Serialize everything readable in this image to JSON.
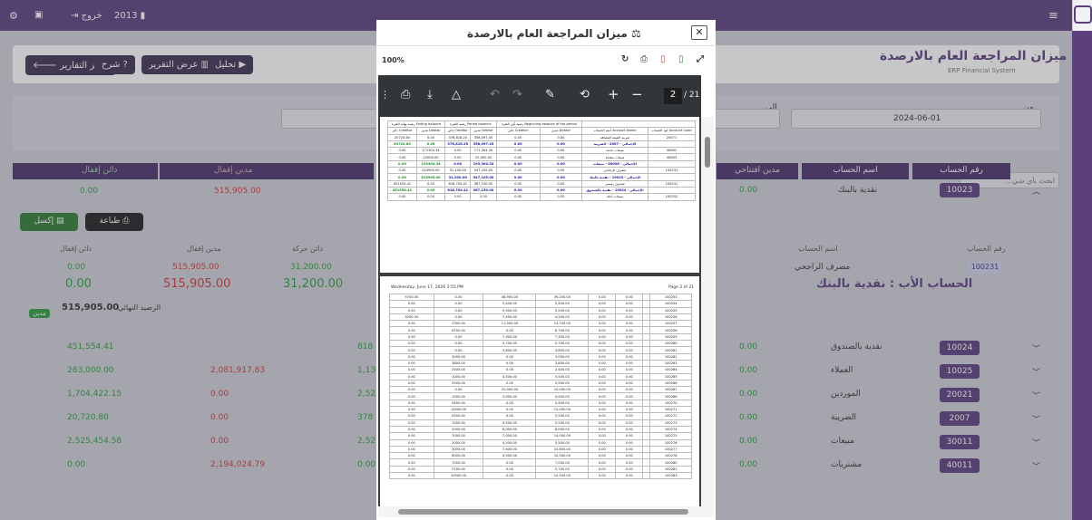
{
  "topbar": {
    "year": "2013",
    "logout": "خروج"
  },
  "header": {
    "title": "ميزان المراجعة العام بالارصدة",
    "subtitle": "ERP Financial System"
  },
  "actions": {
    "reports_center": "مركز التقارير",
    "explain": "شرح",
    "view_report": "عرض التقرير",
    "analysis": "تحليل"
  },
  "filters": {
    "from_label": "من",
    "from_value": "2024-06-01",
    "to_label": "إلى",
    "search_placeholder": "...ابحث بأي شي"
  },
  "table_headers": {
    "account_no": "رقم الحساب",
    "account_name": "اسم الحساب",
    "opening_debit": "مدين افتتاحي",
    "closing_debit": "مدين إقفال",
    "closing_credit": "دائن إقفال"
  },
  "first_row": {
    "code": "10023",
    "name": "نقدية بالبنك",
    "opening": "0.00",
    "closing_debit": "515,905.00",
    "closing_credit": "0.00"
  },
  "export": {
    "print": "طباعة",
    "excel": "إكسل"
  },
  "detail": {
    "h_account_no": "رقم الحساب",
    "h_account_name": "اسم الحساب",
    "h_credit_move": "دائن حركة",
    "h_debit_close": "مدين إقفال",
    "h_credit_close": "دائن إقفال",
    "account_no": "100231",
    "account_name": "مصرف الراجحي",
    "credit_move": "31,200.00",
    "debit_close": "515,905.00",
    "credit_close": "0.00",
    "big_credit_move": "31,200.00",
    "big_debit_close": "515,905.00",
    "big_credit_close": "0.00",
    "parent_title": "الحساب الأب : نقدية بالبنك",
    "final_label": "الرصيد النهائي",
    "final_value": "515,905.00",
    "final_badge": "مدين"
  },
  "rows": [
    {
      "code": "10024",
      "name": "نقدية بالصندوق",
      "opening": "0.00",
      "c1": "451,554.41",
      "c2": "",
      "c3": "818"
    },
    {
      "code": "10025",
      "name": "العملاء",
      "opening": "0.00",
      "c1": "283,000.00",
      "c2": "2,081,917.83",
      "c3": "1,136"
    },
    {
      "code": "20021",
      "name": "الموردين",
      "opening": "0.00",
      "c1": "1,704,422.15",
      "c2": "0.00",
      "c3": "2,523"
    },
    {
      "code": "2007",
      "name": "الضريبة",
      "opening": "0.00",
      "c1": "20,720.80",
      "c2": "0.00",
      "c3": "378"
    },
    {
      "code": "30011",
      "name": "مبيعات",
      "opening": "0.00",
      "c1": "2,525,454.58",
      "c2": "0.00",
      "c3": "2,525"
    },
    {
      "code": "40011",
      "name": "مشتريات",
      "opening": "0.00",
      "c1": "0.00",
      "c2": "2,194,024.79",
      "c3": "0.00"
    }
  ],
  "modal": {
    "title": "ميزان المراجعة العام بالارصدة",
    "zoom": "100%",
    "page_current": "2",
    "page_total": "/ 21"
  },
  "page1": {
    "groups": [
      "رصيد نهاية الفترة",
      "رصيد الفترة",
      "رصيد أول الفترة"
    ],
    "groups_en": [
      "Ending balance",
      "Period balance",
      "Beginning balance of the period"
    ],
    "cols": [
      "دائن",
      "مدين",
      "دائن",
      "مدين",
      "دائن",
      "مدين",
      "اسم الحساب",
      "كود الحساب"
    ],
    "cols_en": [
      "Creditor",
      "Debtor",
      "Creditor",
      "Debtor",
      "Creditor",
      "Debtor",
      "Account Name",
      "Account Code"
    ],
    "rows": [
      [
        "20720.80",
        "0.00",
        "378,818.25",
        "358,097.45",
        "0.00",
        "0.00",
        "ضريبة القيمة المضافة",
        "20071",
        ""
      ],
      [
        "20720.80",
        "0.00",
        "378,818.25",
        "358,097.45",
        "0.00",
        "0.00",
        "الإجمالي - 2007 - الضريبة",
        "",
        "sum"
      ],
      [
        "0.00",
        "171304.34",
        "0.00",
        "171,304.34",
        "0.00",
        "0.00",
        "مبيعات خدمة",
        "40062",
        ""
      ],
      [
        "0.00",
        "22000.00",
        "0.00",
        "22,000.00",
        "0.00",
        "0.00",
        "مبيعات بضاعة",
        "40063",
        ""
      ],
      [
        "0.00",
        "193304.34",
        "0.00",
        "193,304.34",
        "0.00",
        "0.00",
        "الإجمالي - 40006 - مبيعات",
        "",
        "sum"
      ],
      [
        "0.00",
        "515905.00",
        "31,200.00",
        "547,105.00",
        "0.00",
        "0.00",
        "مصرف الراجحي",
        "100231",
        ""
      ],
      [
        "0.00",
        "515905.00",
        "31,200.00",
        "547,105.00",
        "0.00",
        "0.00",
        "الإجمالي - 10023 - نقدية بالبنك",
        "",
        "sum"
      ],
      [
        "451554.41",
        "0.00",
        "818,704.41",
        "367,150.00",
        "0.00",
        "0.00",
        "صندوق رئيسي",
        "100241",
        ""
      ],
      [
        "451554.41",
        "0.00",
        "818,704.41",
        "367,150.00",
        "0.00",
        "0.00",
        "الإجمالي - 10024 - نقدية بالصندوق",
        "",
        "sum"
      ],
      [
        "0.00",
        "0.00",
        "5.00",
        "5.00",
        "0.00",
        "0.00",
        "مبيعات آجلة",
        "100252",
        ""
      ]
    ]
  },
  "page2": {
    "date": "Wednesday, June 17, 2026 3:55 PM",
    "page": "Page 2 of 21",
    "rows": [
      [
        "9700.00",
        "0.00",
        "48,900.00",
        "39,200.00",
        "0.00",
        "0.00",
        "100253"
      ],
      [
        "0.00",
        "0.00",
        "5,400.00",
        "5,400.00",
        "0.00",
        "0.00",
        "100254"
      ],
      [
        "0.00",
        "0.00",
        "5,500.00",
        "5,500.00",
        "0.00",
        "0.00",
        "100255"
      ],
      [
        "3200.00",
        "0.00",
        "7,400.00",
        "4,200.00",
        "0.00",
        "0.00",
        "100256"
      ],
      [
        "0.00",
        "2300.00",
        "11,500.00",
        "13,700.00",
        "0.00",
        "0.00",
        "100257"
      ],
      [
        "0.00",
        "6700.00",
        "0.00",
        "6,700.00",
        "0.00",
        "0.00",
        "100258"
      ],
      [
        "0.00",
        "0.00",
        "7,300.00",
        "7,300.00",
        "0.00",
        "0.00",
        "100259"
      ],
      [
        "0.00",
        "0.00",
        "5,700.00",
        "5,700.00",
        "0.00",
        "0.00",
        "100260"
      ],
      [
        "0.00",
        "0.00",
        "3,800.00",
        "3,800.00",
        "0.00",
        "0.00",
        "100261"
      ],
      [
        "0.00",
        "3000.00",
        "0.00",
        "3,000.00",
        "0.00",
        "0.00",
        "100262"
      ],
      [
        "0.00",
        "3800.00",
        "0.00",
        "3,800.00",
        "0.00",
        "0.00",
        "100263"
      ],
      [
        "0.00",
        "2400.00",
        "0.00",
        "2,400.00",
        "0.00",
        "0.00",
        "100264"
      ],
      [
        "0.00",
        "1000.00",
        "4,500.00",
        "5,500.00",
        "0.00",
        "0.00",
        "100265"
      ],
      [
        "0.00",
        "5500.00",
        "0.00",
        "5,500.00",
        "0.00",
        "0.00",
        "100266"
      ],
      [
        "0.00",
        "0.00",
        "10,000.00",
        "10,000.00",
        "0.00",
        "0.00",
        "100267"
      ],
      [
        "0.00",
        "1000.00",
        "3,900.00",
        "4,900.00",
        "0.00",
        "0.00",
        "100268"
      ],
      [
        "0.00",
        "5400.00",
        "0.00",
        "5,400.00",
        "0.00",
        "0.00",
        "100270"
      ],
      [
        "0.00",
        "12000.00",
        "0.00",
        "12,000.00",
        "0.00",
        "0.00",
        "100271"
      ],
      [
        "0.00",
        "5500.00",
        "0.00",
        "5,500.00",
        "0.00",
        "0.00",
        "100272"
      ],
      [
        "0.00",
        "1000.00",
        "4,500.00",
        "5,500.00",
        "0.00",
        "0.00",
        "100273"
      ],
      [
        "0.00",
        "2000.00",
        "6,000.00",
        "8,000.00",
        "0.00",
        "0.00",
        "100274"
      ],
      [
        "0.00",
        "7000.00",
        "7,000.00",
        "14,000.00",
        "0.00",
        "0.00",
        "100275"
      ],
      [
        "0.00",
        "1000.00",
        "4,500.00",
        "5,500.00",
        "0.00",
        "0.00",
        "100276"
      ],
      [
        "0.00",
        "3000.00",
        "7,600.00",
        "10,600.00",
        "0.00",
        "0.00",
        "100277"
      ],
      [
        "0.00",
        "6000.00",
        "4,500.00",
        "10,500.00",
        "0.00",
        "0.00",
        "100278"
      ],
      [
        "0.00",
        "7000.00",
        "0.00",
        "7,000.00",
        "0.00",
        "0.00",
        "100280"
      ],
      [
        "0.00",
        "5700.00",
        "0.00",
        "5,700.00",
        "0.00",
        "0.00",
        "100282"
      ],
      [
        "0.00",
        "10500.00",
        "0.00",
        "10,500.00",
        "0.00",
        "0.00",
        "100283"
      ]
    ]
  }
}
